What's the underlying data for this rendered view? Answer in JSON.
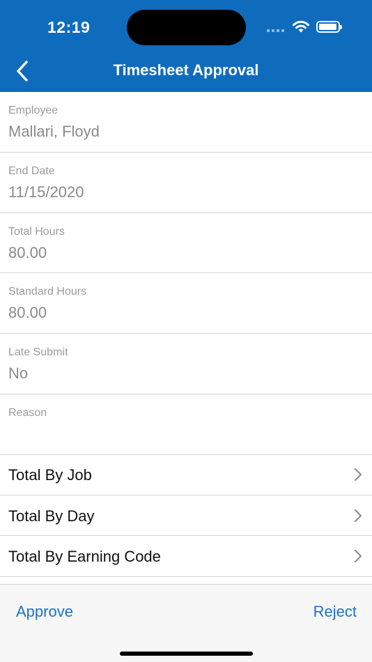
{
  "status_bar": {
    "time": "12:19",
    "icons": [
      "signal-icon",
      "wifi-icon",
      "battery-icon"
    ]
  },
  "nav": {
    "title": "Timesheet Approval",
    "back_icon": "chevron-left-icon"
  },
  "colors": {
    "header_bg": "#0f6cbd",
    "accent": "#1a73c8",
    "label": "#9b9b9b",
    "value": "#8a8a8a"
  },
  "fields": [
    {
      "label": "Employee",
      "value": "Mallari, Floyd"
    },
    {
      "label": "End Date",
      "value": "11/15/2020"
    },
    {
      "label": "Total Hours",
      "value": "80.00"
    },
    {
      "label": "Standard Hours",
      "value": "80.00"
    },
    {
      "label": "Late Submit",
      "value": "No"
    },
    {
      "label": "Reason",
      "value": ""
    }
  ],
  "rows": [
    {
      "label": "Total By Job"
    },
    {
      "label": "Total By Day"
    },
    {
      "label": "Total By Earning Code"
    }
  ],
  "toolbar": {
    "approve_label": "Approve",
    "reject_label": "Reject"
  }
}
